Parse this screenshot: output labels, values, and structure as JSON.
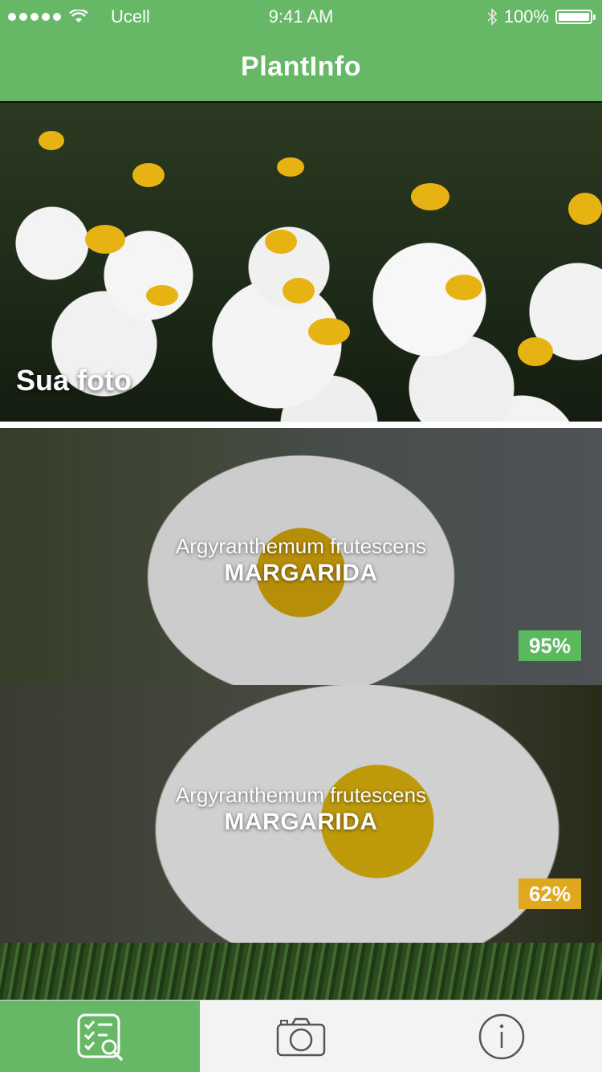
{
  "status_bar": {
    "carrier": "Ucell",
    "time": "9:41 AM",
    "battery": "100%"
  },
  "navbar": {
    "title": "PlantInfo"
  },
  "user_photo": {
    "caption": "Sua foto"
  },
  "results": [
    {
      "scientific_name": "Argyranthemum frutescens",
      "common_name": "MARGARIDA",
      "confidence": "95%",
      "badge_color": "#5cb85c"
    },
    {
      "scientific_name": "Argyranthemum frutescens",
      "common_name": "MARGARIDA",
      "confidence": "62%",
      "badge_color": "#e0a81e"
    }
  ],
  "tab_bar": {
    "tabs": [
      {
        "icon": "checklist-search-icon",
        "active": true
      },
      {
        "icon": "camera-icon",
        "active": false
      },
      {
        "icon": "info-icon",
        "active": false
      }
    ],
    "active_color": "#66b866"
  }
}
